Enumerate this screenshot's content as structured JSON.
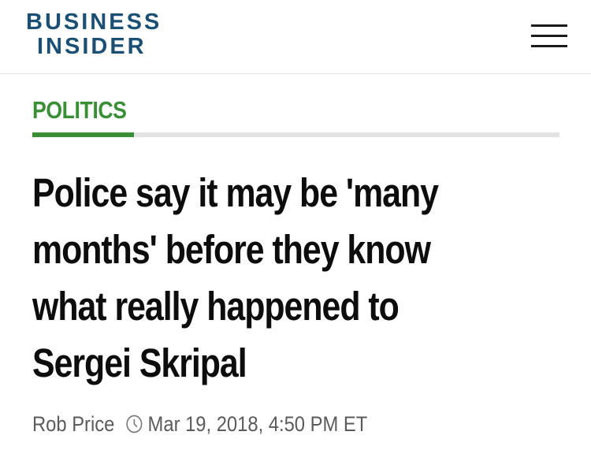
{
  "header": {
    "logo_line1": "BUSINESS",
    "logo_line2": "INSIDER",
    "menu_icon": "hamburger-menu-icon"
  },
  "article": {
    "category": "POLITICS",
    "headline_lines": [
      "Police say it may be 'many",
      "months' before they know",
      "what really happened to",
      "Sergei Skripal"
    ],
    "author": "Rob Price",
    "timestamp_icon": "clock-icon",
    "timestamp": "Mar 19, 2018, 4:50 PM ET"
  },
  "colors": {
    "brand": "#1b4f73",
    "category_accent": "#3a8f36",
    "rule_track": "#e3e3e3",
    "headline_text": "#0d0d0d",
    "byline_text": "#5b5b5b"
  }
}
